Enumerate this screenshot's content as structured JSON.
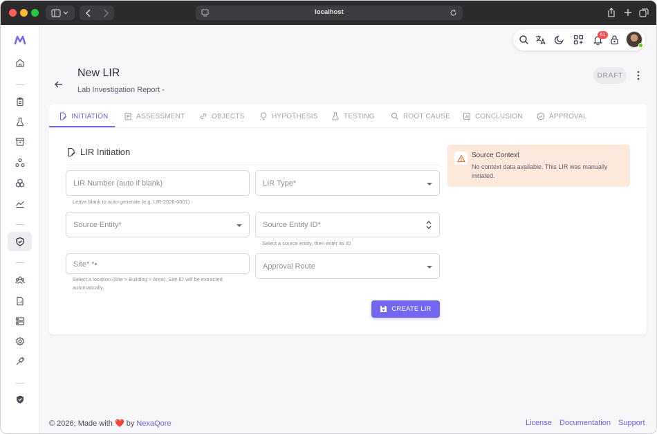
{
  "browser": {
    "url": "localhost"
  },
  "header": {
    "title": "New LIR",
    "subtitle": "Lab Investigation Report -",
    "status": "DRAFT",
    "notification_count": "61"
  },
  "tabs": [
    {
      "label": "INITIATION"
    },
    {
      "label": "ASSESSMENT"
    },
    {
      "label": "OBJECTS"
    },
    {
      "label": "HYPOTHESIS"
    },
    {
      "label": "TESTING"
    },
    {
      "label": "ROOT CAUSE"
    },
    {
      "label": "CONCLUSION"
    },
    {
      "label": "APPROVAL"
    }
  ],
  "form": {
    "section_title": "LIR Initiation",
    "lir_number": {
      "placeholder": "LIR Number (auto if blank)",
      "helper": "Leave blank to auto-generate (e.g. LIR-2026-0001)"
    },
    "lir_type": {
      "placeholder": "LIR Type*"
    },
    "source_entity": {
      "placeholder": "Source Entity*"
    },
    "source_entity_id": {
      "placeholder": "Source Entity ID*",
      "helper": "Select a source entity, then enter its ID"
    },
    "site": {
      "placeholder": "Site* *•",
      "helper": "Select a location (Site > Building > Area). Site ID will be extracted automatically."
    },
    "approval_route": {
      "placeholder": "Approval Route"
    },
    "submit_label": "CREATE LIR"
  },
  "context": {
    "title": "Source Context",
    "text": "No context data available. This LIR was manually initiated."
  },
  "footer": {
    "copyright": "© 2026, Made with",
    "heart": "❤️",
    "by": "by",
    "brand": "NexaQore",
    "links": [
      "License",
      "Documentation",
      "Support"
    ]
  },
  "colors": {
    "primary": "#7367f0",
    "warning_bg": "#fde9dc",
    "danger": "#ff4c51"
  }
}
